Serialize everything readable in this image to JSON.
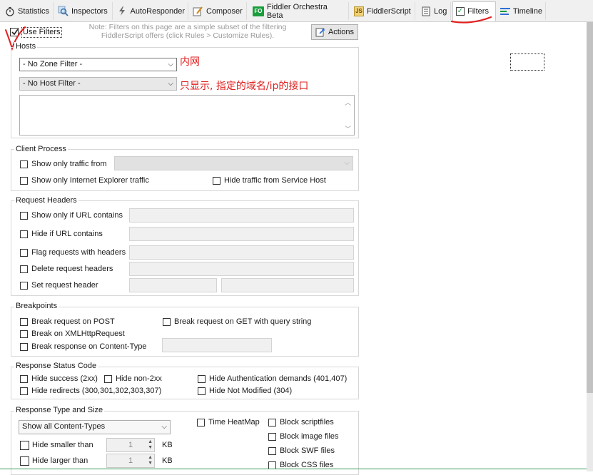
{
  "tabs": [
    {
      "label": "Statistics",
      "icon": "stopwatch-icon"
    },
    {
      "label": "Inspectors",
      "icon": "magnifier-icon"
    },
    {
      "label": "AutoResponder",
      "icon": "lightning-icon"
    },
    {
      "label": "Composer",
      "icon": "pencil-icon"
    },
    {
      "label": "Fiddler Orchestra Beta",
      "icon": "fo-icon",
      "icon_text": "FO"
    },
    {
      "label": "FiddlerScript",
      "icon": "js-icon",
      "icon_text": "JS"
    },
    {
      "label": "Log",
      "icon": "document-icon"
    },
    {
      "label": "Filters",
      "icon": "checkbox-icon",
      "active": true
    },
    {
      "label": "Timeline",
      "icon": "timeline-icon"
    }
  ],
  "use_filters": {
    "label": "Use Filters",
    "checked": true
  },
  "note": {
    "line1": "Note: Filters on this page are a simple subset of the filtering",
    "line2": "FiddlerScript offers (click Rules > Customize Rules)."
  },
  "actions_button": "Actions",
  "hosts": {
    "legend": "Hosts",
    "zone_filter": "- No Zone Filter -",
    "host_filter": "- No Host Filter -",
    "annotation_zone": "内网",
    "annotation_host": "只显示, 指定的域名/ip的接口"
  },
  "client_process": {
    "legend": "Client Process",
    "show_only_traffic_from": "Show only traffic from",
    "show_only_ie": "Show only Internet Explorer traffic",
    "hide_service_host": "Hide traffic from Service Host"
  },
  "request_headers": {
    "legend": "Request Headers",
    "show_only_url": "Show only if URL contains",
    "hide_url": "Hide if URL contains",
    "flag_requests": "Flag requests with headers",
    "delete_headers": "Delete request headers",
    "set_header": "Set request header"
  },
  "breakpoints": {
    "legend": "Breakpoints",
    "break_post": "Break request on POST",
    "break_get": "Break request on GET with query string",
    "break_xhr": "Break on XMLHttpRequest",
    "break_content_type": "Break response on Content-Type"
  },
  "response_status": {
    "legend": "Response Status Code",
    "hide_success": "Hide success (2xx)",
    "hide_non2xx": "Hide non-2xx",
    "hide_auth": "Hide Authentication demands (401,407)",
    "hide_redirects": "Hide redirects (300,301,302,303,307)",
    "hide_not_modified": "Hide Not Modified (304)"
  },
  "response_type": {
    "legend": "Response Type and Size",
    "content_types": "Show all Content-Types",
    "time_heatmap": "Time HeatMap",
    "block_script": "Block scriptfiles",
    "block_image": "Block image files",
    "block_swf": "Block SWF files",
    "block_css": "Block CSS files",
    "hide_smaller": "Hide smaller than",
    "hide_larger": "Hide larger than",
    "smaller_value": "1",
    "larger_value": "1",
    "unit_kb": "KB"
  }
}
